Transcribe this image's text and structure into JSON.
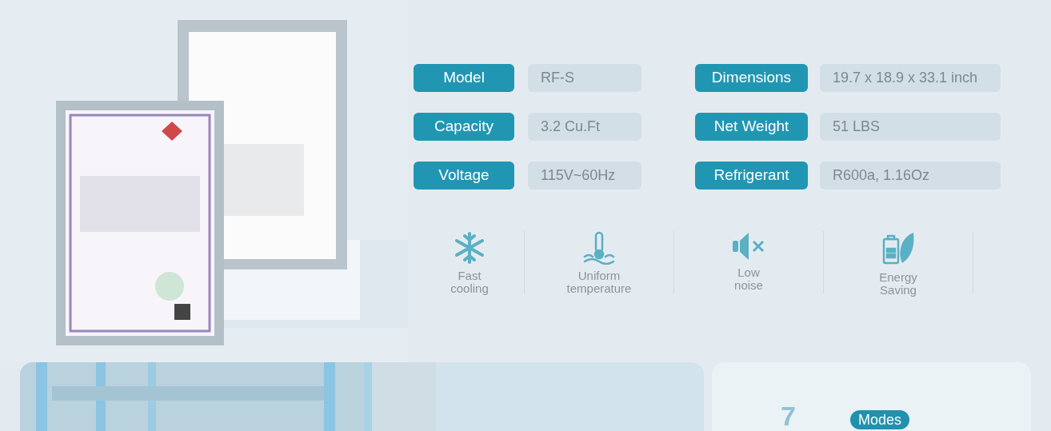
{
  "specs": [
    {
      "label": "Model",
      "value": "RF-S"
    },
    {
      "label": "Dimensions",
      "value": "19.7 x 18.9 x 33.1 inch"
    },
    {
      "label": "Capacity",
      "value": "3.2 Cu.Ft"
    },
    {
      "label": "Net Weight",
      "value": "51 LBS"
    },
    {
      "label": "Voltage",
      "value": "115V~60Hz"
    },
    {
      "label": "Refrigerant",
      "value": "R600a, 1.16Oz"
    }
  ],
  "features": [
    {
      "kind": "snowflake",
      "lines": [
        "Fast",
        "cooling"
      ]
    },
    {
      "kind": "thermometer",
      "lines": [
        "Uniform",
        "temperature"
      ]
    },
    {
      "kind": "mute",
      "lines": [
        "Low",
        "noise"
      ]
    },
    {
      "kind": "battery-leaf",
      "lines": [
        "Energy",
        "Saving"
      ]
    }
  ],
  "modes_card": {
    "number": "7",
    "badge": "Modes"
  }
}
